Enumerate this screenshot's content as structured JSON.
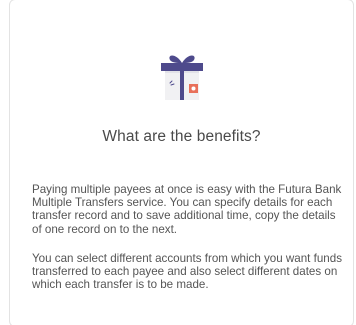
{
  "benefits": {
    "icon": "gift-icon",
    "title": "What are the benefits?",
    "paragraphs": [
      "Paying multiple payees at once is easy with the Futura Bank Multiple Transfers service. You can specify details for each transfer record and to save additional time, copy the details of one record on to the next.",
      "You can select different accounts from which you want funds transferred to each payee and also select different dates on which each transfer is to be made."
    ]
  },
  "colors": {
    "gift_ribbon": "#4e4a8c",
    "gift_accent": "#e8705a",
    "gift_box": "#f1f1f3"
  }
}
